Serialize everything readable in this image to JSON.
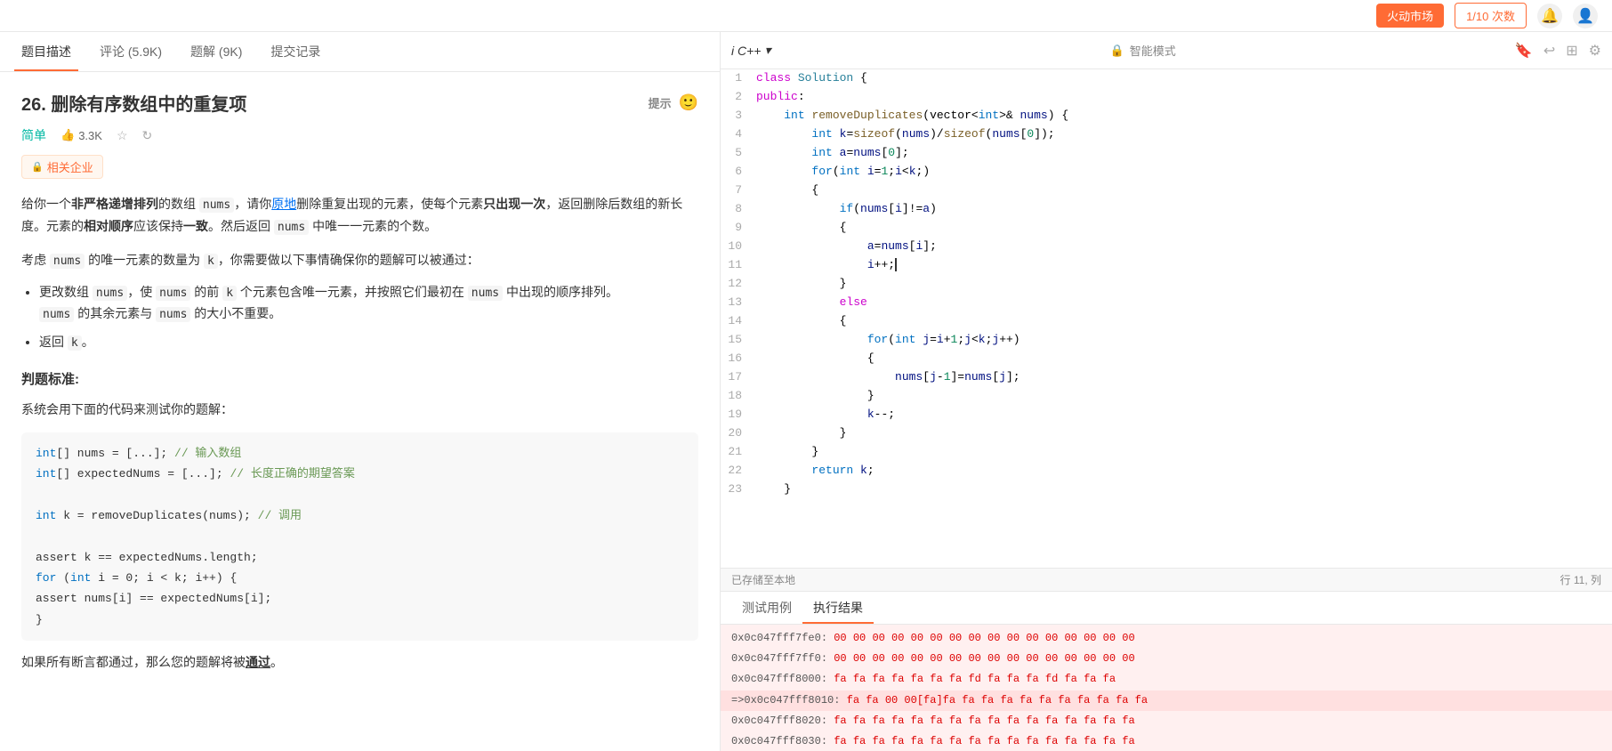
{
  "topbar": {
    "fire_button": "火动市场",
    "login_button": "1/10 次数",
    "icon1": "☆",
    "icon2": "☆"
  },
  "tabs": [
    {
      "label": "题目描述",
      "active": true
    },
    {
      "label": "评论 (5.9K)",
      "active": false
    },
    {
      "label": "题解 (9K)",
      "active": false
    },
    {
      "label": "提交记录",
      "active": false
    }
  ],
  "problem": {
    "number": "26.",
    "title": "删除有序数组中的重复项",
    "hint": "提示",
    "difficulty": "简单",
    "likes": "3.3K",
    "company_tag": "相关企业",
    "description_p1": "给你一个",
    "desc_bold1": "非严格递增排列",
    "desc_p1b": "的数组",
    "desc_code1": "nums",
    "desc_p1c": "，请你",
    "desc_link1": "原地",
    "desc_p1d": "删除重复出现的元素，使每个元素",
    "desc_bold2": "只出现一次",
    "desc_p1e": "，返回删除后数组的新长度。元素的",
    "desc_bold3": "相对顺序",
    "desc_p1f": "应该保持",
    "desc_bold4": "一致",
    "desc_p1g": "。然后返回",
    "desc_code2": "nums",
    "desc_p1h": "中唯一一元素的个数。",
    "desc_p2": "考虑",
    "desc_code3": "nums",
    "desc_p2b": "的唯一元素的数量为",
    "desc_code4": "k",
    "desc_p2c": "，你需要做以下事情确保你的题解可以被通过：",
    "bullet1_p1": "更改数组",
    "bullet1_code1": "nums",
    "bullet1_p2": "，使",
    "bullet1_code2": "nums",
    "bullet1_p3": "的前",
    "bullet1_code3": "k",
    "bullet1_p4": "个元素包含唯一元素，并按照它们最初在",
    "bullet1_code4": "nums",
    "bullet1_p5": "中出现的顺序排列。",
    "bullet1_p6": "nums",
    "bullet1_p7": "的其余元素与",
    "bullet1_code5": "nums",
    "bullet1_p8": "的大小不重要。",
    "bullet2": "返回",
    "bullet2_code": "k",
    "bullet2_end": "。",
    "judge_title": "判题标准:",
    "judge_desc": "系统会用下面的代码来测试你的题解：",
    "judge_code_lines": [
      "    int[] nums = [...]; // 输入数组",
      "    int[] expectedNums = [...]; // 长度正确的期望答案",
      "",
      "    int k = removeDuplicates(nums); // 调用",
      "",
      "    assert k == expectedNums.length;",
      "    for (int i = 0; i < k; i++) {",
      "        assert nums[i] == expectedNums[i];",
      "    }",
      ""
    ],
    "judge_comments": [
      "// 输入数组",
      "// 长度正确的期望答案",
      "",
      "// 调用",
      "",
      "",
      "",
      "",
      "",
      ""
    ],
    "pass_text": "如果所有断言都通过，那么您的题解将被",
    "pass_bold": "通过",
    "pass_end": "。"
  },
  "editor": {
    "lang": "i C++",
    "smart_mode": "智能模式",
    "saved_text": "已存储至本地",
    "cursor_pos": "行 11, 列",
    "code_lines": [
      {
        "num": 1,
        "content": "class Solution {"
      },
      {
        "num": 2,
        "content": "public:"
      },
      {
        "num": 3,
        "content": "    int removeDuplicates(vector<int>& nums) {"
      },
      {
        "num": 4,
        "content": "        int k=sizeof(nums)/sizeof(nums[0]);"
      },
      {
        "num": 5,
        "content": "        int a=nums[0];"
      },
      {
        "num": 6,
        "content": "        for(int i=1;i<k;)"
      },
      {
        "num": 7,
        "content": "        {"
      },
      {
        "num": 8,
        "content": "            if(nums[i]!=a)"
      },
      {
        "num": 9,
        "content": "            {"
      },
      {
        "num": 10,
        "content": "                a=nums[i];"
      },
      {
        "num": 11,
        "content": "                i++;|"
      },
      {
        "num": 12,
        "content": "            }"
      },
      {
        "num": 13,
        "content": "            else"
      },
      {
        "num": 14,
        "content": "            {"
      },
      {
        "num": 15,
        "content": "                for(int j=i+1;j<k;j++)"
      },
      {
        "num": 16,
        "content": "                {"
      },
      {
        "num": 17,
        "content": "                    nums[j-1]=nums[j];"
      },
      {
        "num": 18,
        "content": "                }"
      },
      {
        "num": 19,
        "content": "                k--;"
      },
      {
        "num": 20,
        "content": "            }"
      },
      {
        "num": 21,
        "content": "        }"
      },
      {
        "num": 22,
        "content": "        return k;"
      },
      {
        "num": 23,
        "content": "    }"
      }
    ]
  },
  "bottom": {
    "tabs": [
      {
        "label": "测试用例",
        "active": false
      },
      {
        "label": "执行结果",
        "active": true
      }
    ],
    "hex_lines": [
      {
        "addr": "0x0c047fff7fe0:",
        "data": "00 00 00 00 00 00 00 00 00 00 00 00 00 00 00 00"
      },
      {
        "addr": "0x0c047fff7ff0:",
        "data": "00 00 00 00 00 00 00 00 00 00 00 00 00 00 00 00"
      },
      {
        "addr": "0x0c047fff8000:",
        "data": "fa fa fa fa fa fa fa fd fa fa fa fd fa fa fa"
      },
      {
        "addr": "=>0x0c047fff8010:",
        "data": "fa fa 00 00[fa]fa fa fa fa fa fa fa fa fa fa fa",
        "highlight": true
      },
      {
        "addr": "0x0c047fff8020:",
        "data": "fa fa fa fa fa fa fa fa fa fa fa fa fa fa fa fa"
      },
      {
        "addr": "0x0c047fff8030:",
        "data": "fa fa fa fa fa fa fa fa fa fa fa fa fa fa fa fa"
      }
    ]
  }
}
